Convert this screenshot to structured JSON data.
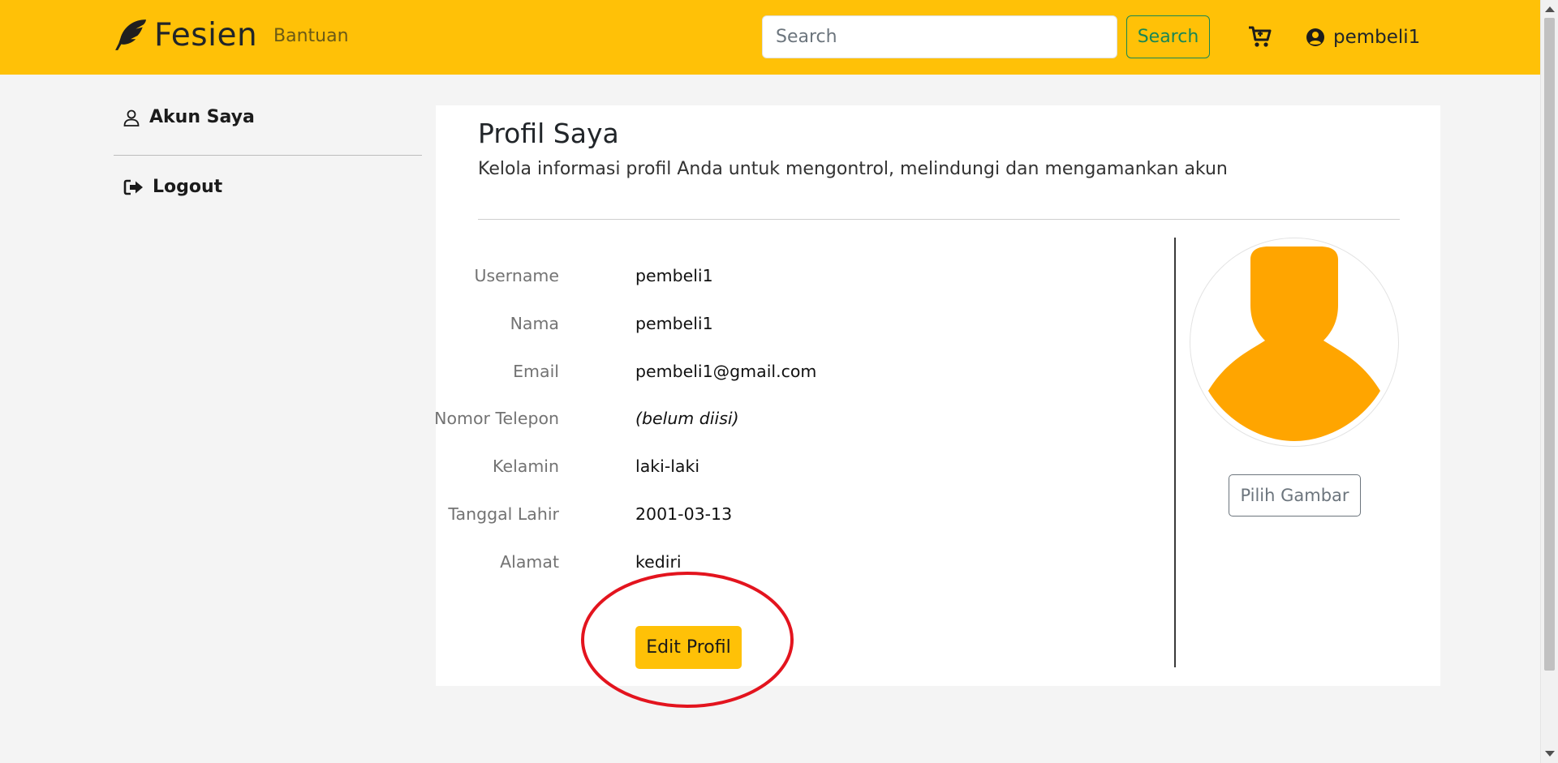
{
  "navbar": {
    "brand": "Fesien",
    "help_link": "Bantuan",
    "search_placeholder": "Search",
    "search_button": "Search",
    "username": "pembeli1",
    "bg_color": "#ffc107"
  },
  "sidebar": {
    "account_label": "Akun Saya",
    "logout_label": "Logout"
  },
  "profile": {
    "title": "Profil Saya",
    "subtitle": "Kelola informasi profil Anda untuk mengontrol, melindungi dan mengamankan akun",
    "fields": [
      {
        "label": "Username",
        "value": "pembeli1"
      },
      {
        "label": "Nama",
        "value": "pembeli1"
      },
      {
        "label": "Email",
        "value": "pembeli1@gmail.com"
      },
      {
        "label": "Nomor Telepon",
        "value": "(belum diisi)"
      },
      {
        "label": "Kelamin",
        "value": "laki-laki"
      },
      {
        "label": "Tanggal Lahir",
        "value": "2001-03-13"
      },
      {
        "label": "Alamat",
        "value": "kediri"
      }
    ],
    "edit_button": "Edit Profil",
    "pick_image_button": "Pilih Gambar",
    "avatar_color": "#ffa500",
    "annotation_color": "#e3141e"
  },
  "icons": {
    "brand": "feather-icon",
    "cart": "cart-icon",
    "user": "user-circle-icon",
    "account": "person-outline-icon",
    "logout": "sign-out-icon"
  }
}
